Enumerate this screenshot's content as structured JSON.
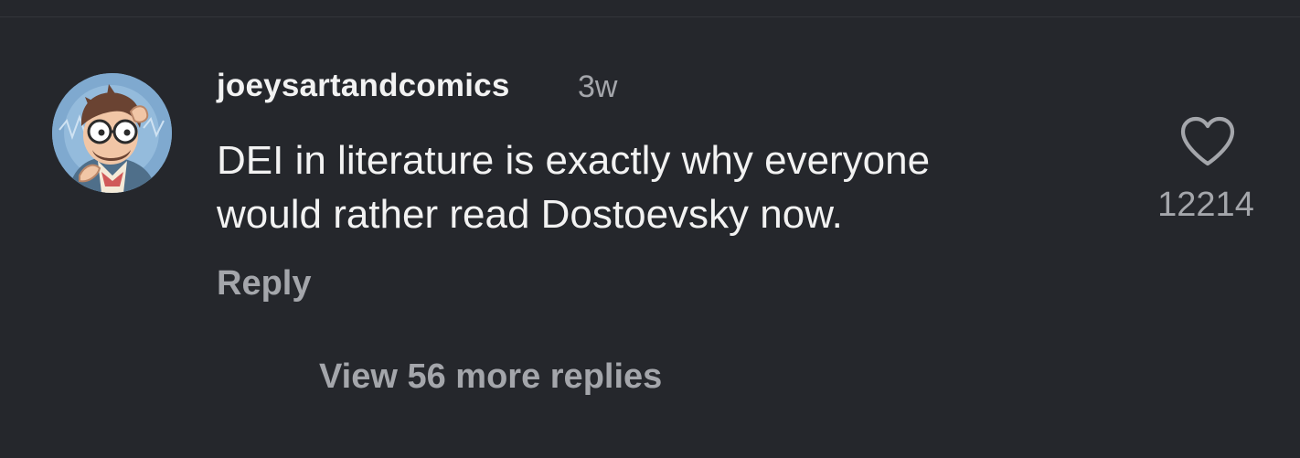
{
  "comment": {
    "username": "joeysartandcomics",
    "timestamp": "3w",
    "text_lines": [
      "DEI in literature is exactly why everyone",
      "would rather read Dostoevsky now."
    ],
    "reply_label": "Reply",
    "like_icon": "heart-outline-icon",
    "like_count": "12214",
    "view_replies_label": "View 56 more replies"
  },
  "colors": {
    "background": "#25272c",
    "primary_text": "#f2f2f2",
    "secondary_text": "#a4a6ab",
    "avatar_background": "#7fa9cf"
  }
}
